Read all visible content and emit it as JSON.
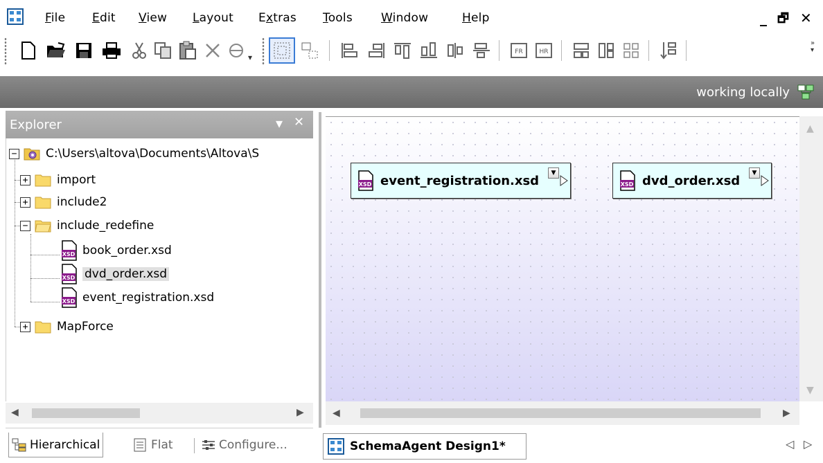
{
  "menu": {
    "items": [
      {
        "pre": "",
        "u": "F",
        "post": "ile"
      },
      {
        "pre": "",
        "u": "E",
        "post": "dit"
      },
      {
        "pre": "",
        "u": "V",
        "post": "iew"
      },
      {
        "pre": "",
        "u": "L",
        "post": "ayout"
      },
      {
        "pre": "E",
        "u": "x",
        "post": "tras"
      },
      {
        "pre": "",
        "u": "T",
        "post": "ools"
      },
      {
        "pre": "",
        "u": "W",
        "post": "indow"
      },
      {
        "pre": "",
        "u": "H",
        "post": "elp"
      }
    ],
    "minimize": "_",
    "restore": "🗗",
    "close": "✕"
  },
  "toolbar": {
    "icons": [
      "new-icon",
      "open-icon",
      "save-icon",
      "print-icon",
      "cut-icon",
      "copy-icon",
      "paste-icon",
      "delete-icon",
      "find-icon"
    ]
  },
  "status": {
    "text": "working locally"
  },
  "explorer": {
    "title": "Explorer",
    "dropdown": "▾",
    "close": "✕",
    "root": "C:\\Users\\altova\\Documents\\Altova\\S",
    "items": [
      {
        "label": "import",
        "expander": "+"
      },
      {
        "label": "include2",
        "expander": "+"
      },
      {
        "label": "include_redefine",
        "expander": "−"
      },
      {
        "label": "book_order.xsd"
      },
      {
        "label": "dvd_order.xsd"
      },
      {
        "label": "event_registration.xsd"
      },
      {
        "label": "MapForce",
        "expander": "+"
      }
    ],
    "root_expander": "−"
  },
  "explorer_tabs": {
    "hierarchical": "Hierarchical",
    "flat": "Flat",
    "configure": "Configure..."
  },
  "design": {
    "schemas": [
      {
        "name": "event_registration.xsd"
      },
      {
        "name": "dvd_order.xsd"
      }
    ],
    "tab_label": "SchemaAgent Design1*",
    "nav_prev": "◁",
    "nav_next": "▷"
  },
  "colors": {
    "schema_box_bg": "#e6ffff",
    "xsd_icon": "#8b1a8b",
    "folder": "#f0c64a",
    "status_strip": "#777777"
  }
}
